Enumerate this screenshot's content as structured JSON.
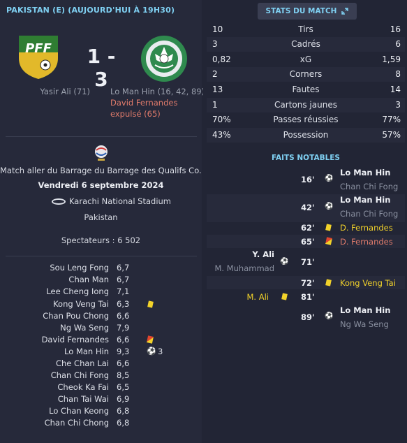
{
  "header": {
    "title": "PAKISTAN (E) (AUJOURD'HUI À 19H30)"
  },
  "match": {
    "home_logo_text": "PFF",
    "score": "1 - 3",
    "home_scorers": "Yasir Ali (71)",
    "away_scorers": "Lo Man Hin (16, 42, 89)",
    "away_red_line1": "David Fernandes",
    "away_red_line2": "expulsé (65)",
    "competition": "Match aller du Barrage du Barrage des Qualifs Co...",
    "date": "Vendredi 6 septembre 2024",
    "stadium": "Karachi National Stadium",
    "country": "Pakistan",
    "spectators": "Spectateurs : 6 502"
  },
  "players": [
    {
      "name": "Sou Leng Fong",
      "rating": "6,7"
    },
    {
      "name": "Chan Man",
      "rating": "6,7"
    },
    {
      "name": "Lee Cheng Iong",
      "rating": "7,1"
    },
    {
      "name": "Kong Veng Tai",
      "rating": "6,3",
      "card": "yellow"
    },
    {
      "name": "Chan Pou Chong",
      "rating": "6,6"
    },
    {
      "name": "Ng Wa Seng",
      "rating": "7,9"
    },
    {
      "name": "David Fernandes",
      "rating": "6,6",
      "card": "red"
    },
    {
      "name": "Lo Man Hin",
      "rating": "9,3",
      "goals": "3"
    },
    {
      "name": "Che Chan Lai",
      "rating": "6,6"
    },
    {
      "name": "Chan Chi Fong",
      "rating": "8,5"
    },
    {
      "name": "Cheok Ka Fai",
      "rating": "6,5"
    },
    {
      "name": "Chan Tai Wai",
      "rating": "6,9"
    },
    {
      "name": "Lo Chan Keong",
      "rating": "6,8"
    },
    {
      "name": "Chan Chi Chong",
      "rating": "6,8"
    }
  ],
  "stats": {
    "button_label": "STATS DU MATCH",
    "rows": [
      {
        "home": "10",
        "label": "Tirs",
        "away": "16"
      },
      {
        "home": "3",
        "label": "Cadrés",
        "away": "6"
      },
      {
        "home": "0,82",
        "label": "xG",
        "away": "1,59"
      },
      {
        "home": "2",
        "label": "Corners",
        "away": "8"
      },
      {
        "home": "13",
        "label": "Fautes",
        "away": "14"
      },
      {
        "home": "1",
        "label": "Cartons jaunes",
        "away": "3"
      },
      {
        "home": "70%",
        "label": "Passes réussies",
        "away": "77%"
      },
      {
        "home": "43%",
        "label": "Possession",
        "away": "57%"
      }
    ]
  },
  "events": {
    "title": "FAITS NOTABLES",
    "items": [
      {
        "minute": "16'",
        "name": "Lo Man Hin",
        "sub": "Chan Chi Fong"
      },
      {
        "minute": "42'",
        "name": "Lo Man Hin",
        "sub": "Chan Chi Fong"
      },
      {
        "minute": "62'",
        "name": "D. Fernandes"
      },
      {
        "minute": "65'",
        "name": "D. Fernandes"
      },
      {
        "minute": "71'",
        "name": "Y. Ali",
        "sub": "M. Muhammad"
      },
      {
        "minute": "72'",
        "name": "Kong Veng Tai"
      },
      {
        "minute": "81'",
        "name": "M. Ali"
      },
      {
        "minute": "89'",
        "name": "Lo Man Hin",
        "sub": "Ng Wa Seng"
      }
    ]
  },
  "colors": {
    "accent": "#7fd0f2",
    "yellow": "#f2d22a",
    "red": "#e07b6b",
    "bg": "#222535"
  }
}
